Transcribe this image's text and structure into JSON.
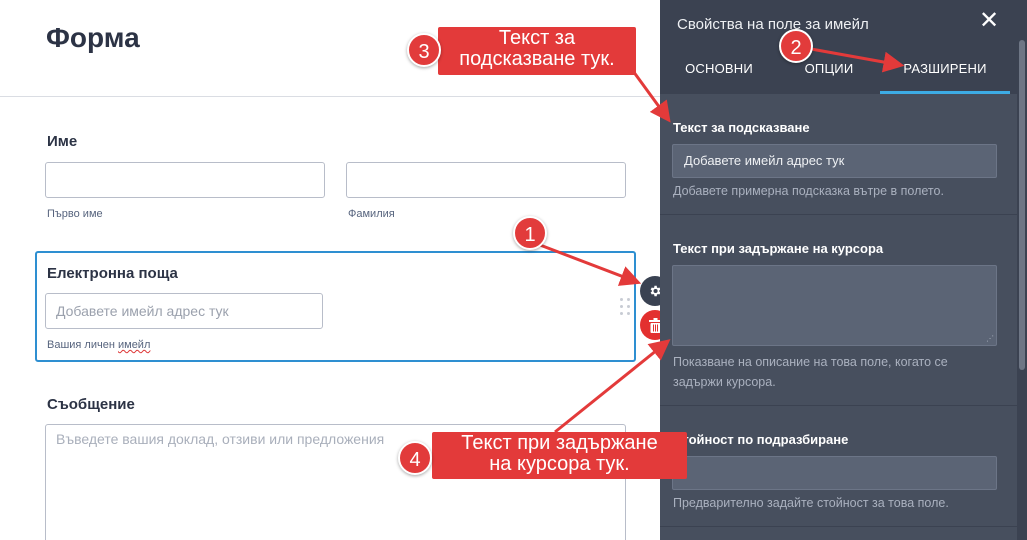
{
  "form": {
    "title": "Форма",
    "name": {
      "label": "Име",
      "first_sublabel": "Първо име",
      "last_sublabel": "Фамилия",
      "first_value": "",
      "last_value": ""
    },
    "email": {
      "label": "Електронна поща",
      "placeholder": "Добавете имейл адрес тук",
      "sublabel_prefix": "Вашия личен ",
      "sublabel_misspelled": "имейл"
    },
    "message": {
      "label": "Съобщение",
      "placeholder": "Въведете вашия доклад, отзиви или предложения"
    }
  },
  "panel": {
    "title": "Свойства на поле за имейл",
    "close_symbol": "✕",
    "tabs": [
      {
        "label": "ОСНОВНИ",
        "active": false
      },
      {
        "label": "ОПЦИИ",
        "active": false
      },
      {
        "label": "РАЗШИРЕНИ",
        "active": true
      }
    ],
    "placeholder_section": {
      "label": "Текст за подсказване",
      "value": "Добавете имейл адрес тук",
      "help": "Добавете примерна подсказка вътре в полето."
    },
    "hover_section": {
      "label": "Текст при задържане на курсора",
      "value": "",
      "help_line1": "Показване на описание на това поле, когато се",
      "help_line2": "задържи курсора."
    },
    "default_section": {
      "label": "Стойност по подразбиране",
      "value": "",
      "help": "Предварително задайте стойност за това поле."
    }
  },
  "annotations": [
    {
      "number": "1"
    },
    {
      "number": "2"
    },
    {
      "number": "3",
      "text_line1": "Текст за",
      "text_line2": "подсказване тук."
    },
    {
      "number": "4",
      "text_line1": "Текст при задържане",
      "text_line2": "на курсора тук."
    }
  ],
  "colors": {
    "accent": "#2e8fd1",
    "tab_underline": "#3dace5",
    "annotation_red": "#e33a3a",
    "panel_bg": "#474f5e",
    "top_bar": "#f0882a"
  },
  "icons": {
    "gear": "gear-icon",
    "trash": "trash-icon",
    "close": "close-icon",
    "drag": "drag-handle-icon"
  }
}
